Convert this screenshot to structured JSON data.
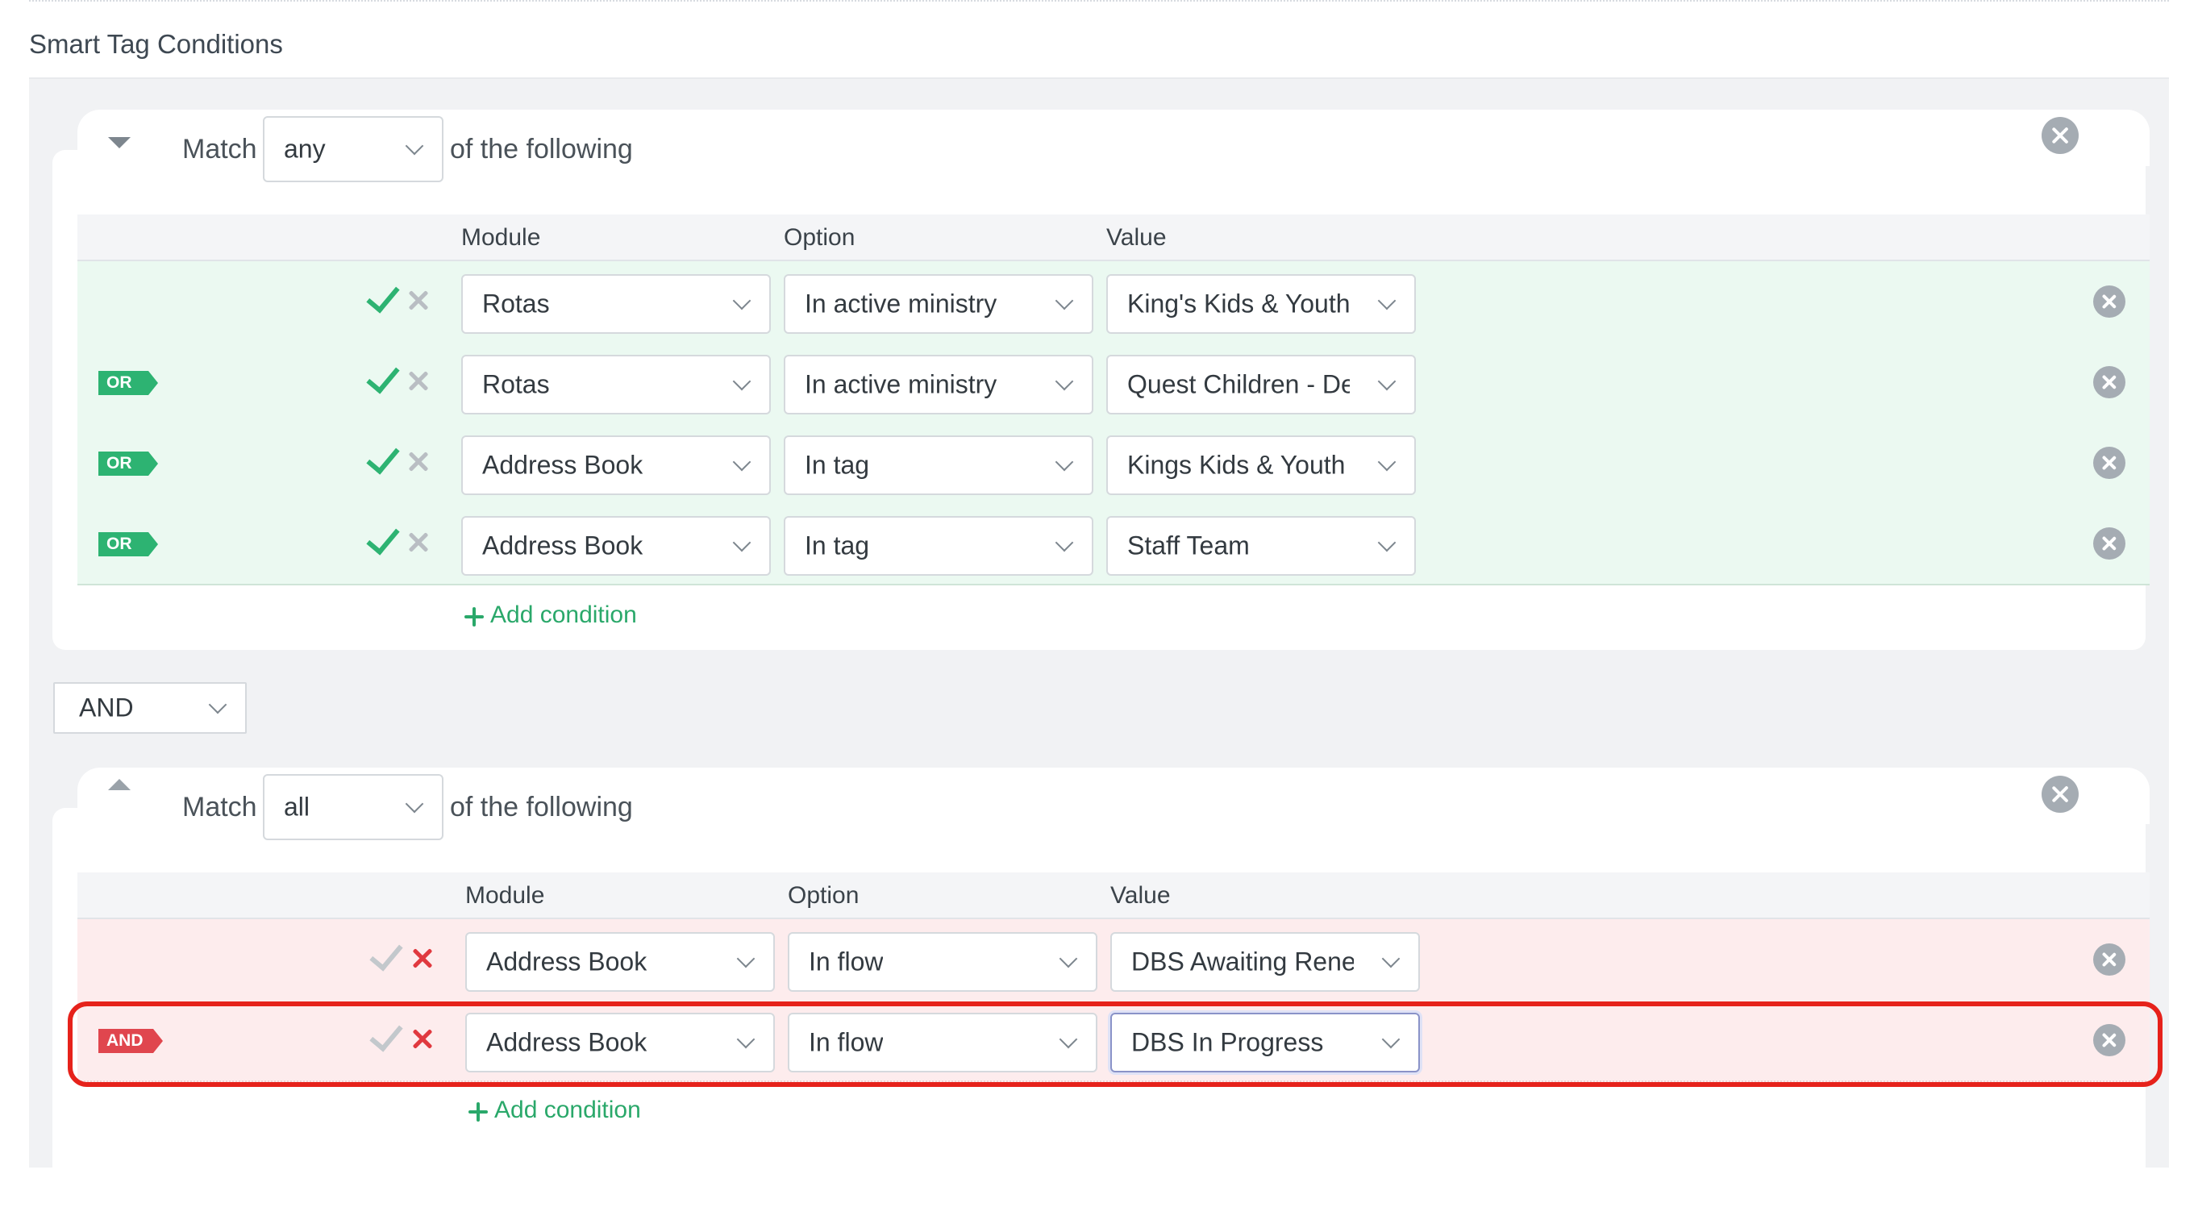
{
  "section_title": "Smart Tag Conditions",
  "groups": [
    {
      "match_label": "Match",
      "match_value": "any",
      "following_label": "of the following",
      "headers": {
        "module": "Module",
        "option": "Option",
        "value": "Value"
      },
      "rows": [
        {
          "badge": "",
          "module": "Rotas",
          "option": "In active ministry",
          "value": "King's Kids & Youth (S"
        },
        {
          "badge": "OR",
          "module": "Rotas",
          "option": "In active ministry",
          "value": "Quest Children - Derk"
        },
        {
          "badge": "OR",
          "module": "Address Book",
          "option": "In tag",
          "value": "Kings Kids & Youth Te"
        },
        {
          "badge": "OR",
          "module": "Address Book",
          "option": "In tag",
          "value": "Staff Team"
        }
      ],
      "add_condition": "Add condition"
    },
    {
      "match_label": "Match",
      "match_value": "all",
      "following_label": "of the following",
      "headers": {
        "module": "Module",
        "option": "Option",
        "value": "Value"
      },
      "rows": [
        {
          "badge": "",
          "module": "Address Book",
          "option": "In flow",
          "value": "DBS Awaiting Renewa"
        },
        {
          "badge": "AND",
          "module": "Address Book",
          "option": "In flow",
          "value": "DBS In Progress"
        }
      ],
      "add_condition": "Add condition"
    }
  ],
  "group_joiner": "AND",
  "colors": {
    "accent_green": "#2db372",
    "accent_red": "#e0464e",
    "highlight": "#e6221b"
  }
}
